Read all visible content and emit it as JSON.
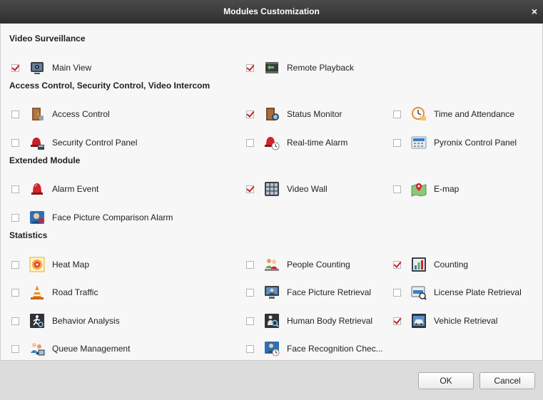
{
  "window": {
    "title": "Modules Customization",
    "close_glyph": "×"
  },
  "sections": {
    "video_surveillance": "Video Surveillance",
    "access_control": "Access Control, Security Control, Video Intercom",
    "extended": "Extended Module",
    "statistics": "Statistics"
  },
  "modules": {
    "main_view": {
      "label": "Main View",
      "checked": true,
      "icon": "main-view-icon"
    },
    "remote_playback": {
      "label": "Remote Playback",
      "checked": true,
      "icon": "remote-playback-icon"
    },
    "access_control": {
      "label": "Access Control",
      "checked": false,
      "icon": "door-icon"
    },
    "status_monitor": {
      "label": "Status Monitor",
      "checked": true,
      "icon": "status-monitor-icon"
    },
    "time_attendance": {
      "label": "Time and Attendance",
      "checked": false,
      "icon": "clock-icon"
    },
    "security_control_panel": {
      "label": "Security Control Panel",
      "checked": false,
      "icon": "alarm-panel-icon"
    },
    "realtime_alarm": {
      "label": "Real-time Alarm",
      "checked": false,
      "icon": "siren-clock-icon"
    },
    "pyronix_control_panel": {
      "label": "Pyronix Control Panel",
      "checked": false,
      "icon": "keypad-icon"
    },
    "alarm_event": {
      "label": "Alarm Event",
      "checked": false,
      "icon": "siren-icon"
    },
    "video_wall": {
      "label": "Video Wall",
      "checked": true,
      "icon": "video-wall-icon"
    },
    "e_map": {
      "label": "E-map",
      "checked": false,
      "icon": "map-icon"
    },
    "face_picture_comparison_alarm": {
      "label": "Face Picture Comparison Alarm",
      "checked": false,
      "icon": "face-alarm-icon"
    },
    "heat_map": {
      "label": "Heat Map",
      "checked": false,
      "icon": "heat-map-icon"
    },
    "people_counting": {
      "label": "People Counting",
      "checked": false,
      "icon": "people-counting-icon"
    },
    "counting": {
      "label": "Counting",
      "checked": true,
      "icon": "counting-chart-icon"
    },
    "road_traffic": {
      "label": "Road Traffic",
      "checked": false,
      "icon": "traffic-cone-icon"
    },
    "face_picture_retrieval": {
      "label": "Face Picture Retrieval",
      "checked": false,
      "icon": "face-retrieval-icon"
    },
    "license_plate_retrieval": {
      "label": "License Plate Retrieval",
      "checked": false,
      "icon": "license-plate-icon"
    },
    "behavior_analysis": {
      "label": "Behavior Analysis",
      "checked": false,
      "icon": "behavior-analysis-icon"
    },
    "human_body_retrieval": {
      "label": "Human Body Retrieval",
      "checked": false,
      "icon": "human-body-icon"
    },
    "vehicle_retrieval": {
      "label": "Vehicle Retrieval",
      "checked": true,
      "icon": "vehicle-icon"
    },
    "queue_management": {
      "label": "Queue Management",
      "checked": false,
      "icon": "queue-icon"
    },
    "face_recognition_check": {
      "label": "Face Recognition Chec...",
      "checked": false,
      "icon": "face-recognition-icon"
    }
  },
  "buttons": {
    "ok": "OK",
    "cancel": "Cancel"
  },
  "colors": {
    "titlebar": "#353535",
    "check": "#c8202a",
    "content_bg": "#f7f7f7",
    "footer_bg": "#dcdcdc"
  }
}
